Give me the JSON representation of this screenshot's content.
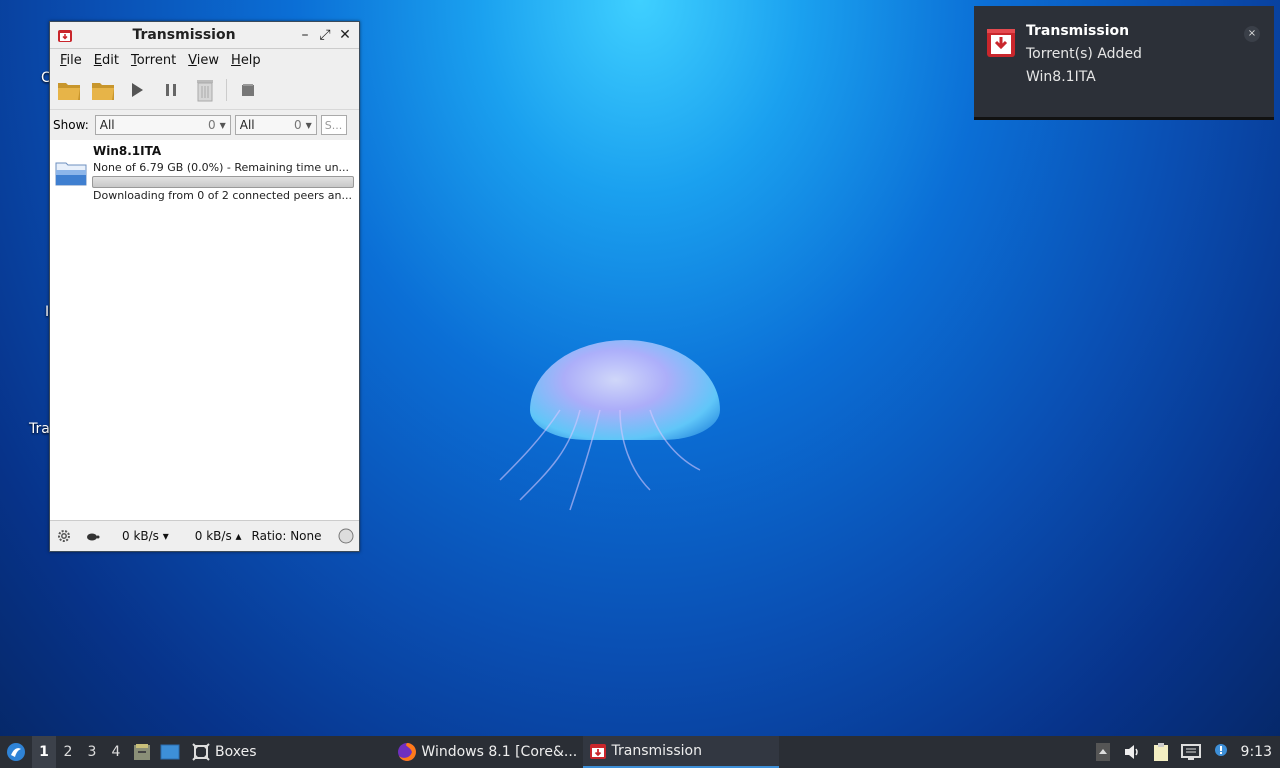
{
  "desktop": {
    "labels": [
      "C",
      "I",
      "Tra"
    ]
  },
  "window": {
    "title": "Transmission",
    "controls": {
      "minimize": "–",
      "maximize": "⤢",
      "close": "✕"
    },
    "menu": [
      "File",
      "Edit",
      "Torrent",
      "View",
      "Help"
    ],
    "toolbar": [
      "open-icon",
      "open-url-icon",
      "start-icon",
      "pause-icon",
      "remove-icon",
      "properties-icon"
    ],
    "filter": {
      "label": "Show:",
      "activity": {
        "value": "All",
        "count": "0"
      },
      "tracker": {
        "value": "All",
        "count": "0"
      },
      "search_placeholder": "S..."
    },
    "torrents": [
      {
        "name": "Win8.1ITA",
        "progress_text": "None of 6.79 GB (0.0%) - Remaining time un...",
        "progress": 0.0,
        "status_text": "Downloading from 0 of 2 connected peers an..."
      }
    ],
    "statusbar": {
      "down": "0 kB/s ▾",
      "up": "0 kB/s ▴",
      "ratio": "Ratio: None"
    }
  },
  "notification": {
    "app": "Transmission",
    "summary": "Torrent(s) Added",
    "body": "Win8.1ITA",
    "close": "×"
  },
  "taskbar": {
    "workspaces": [
      "1",
      "2",
      "3",
      "4"
    ],
    "active_workspace": "1",
    "tasks": [
      {
        "label": "Boxes",
        "icon": "boxes-icon"
      },
      {
        "label": "Windows 8.1 [Core&...",
        "icon": "firefox-icon"
      },
      {
        "label": "Transmission",
        "icon": "transmission-icon"
      }
    ],
    "clock": "9:13"
  },
  "colors": {
    "accent": "#3d8fd8",
    "notification_bg": "#2c3038",
    "taskbar_bg": "#2a2e35"
  }
}
